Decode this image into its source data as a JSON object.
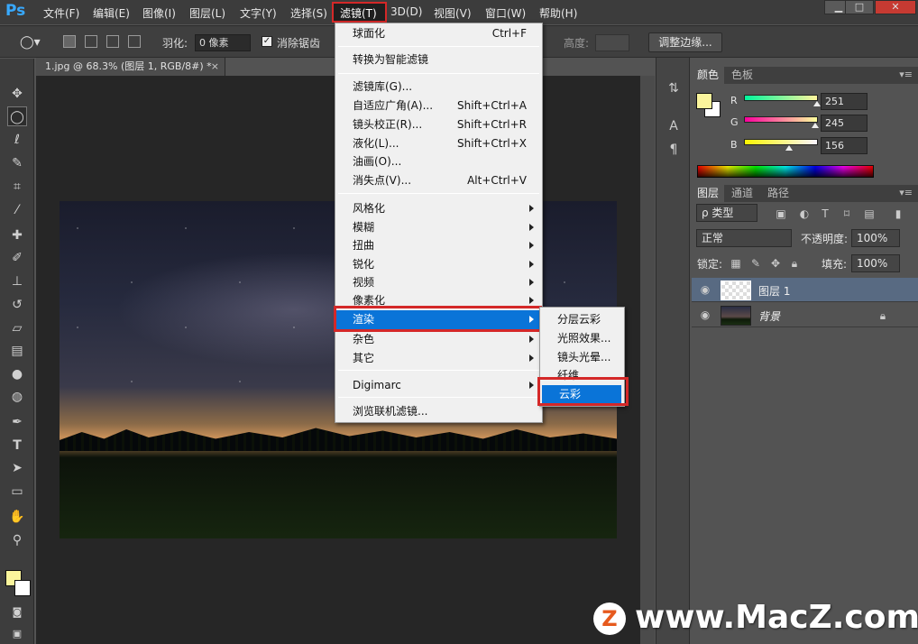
{
  "app": {
    "logo": "Ps"
  },
  "menubar": {
    "items": [
      "文件(F)",
      "编辑(E)",
      "图像(I)",
      "图层(L)",
      "文字(Y)",
      "选择(S)",
      "滤镜(T)",
      "3D(D)",
      "视图(V)",
      "窗口(W)",
      "帮助(H)"
    ],
    "active_item": "滤镜(T)"
  },
  "window_controls": {
    "minimize": "▁",
    "maximize": "□",
    "close": "✕"
  },
  "options_bar": {
    "feather_label": "羽化:",
    "feather_value": "0 像素",
    "antialias_label": "消除锯齿",
    "antialias_checked": "✓",
    "height_label": "高度:",
    "refine_edge_button": "调整边缘..."
  },
  "document": {
    "tab_title": "1.jpg @ 68.3% (图层 1, RGB/8#) *",
    "tab_close": "×"
  },
  "tools": [
    "move-icon",
    "marquee-icon",
    "lasso-icon",
    "quick-select-icon",
    "crop-icon",
    "eyedropper-icon",
    "healing-icon",
    "brush-icon",
    "stamp-icon",
    "history-brush-icon",
    "eraser-icon",
    "gradient-icon",
    "blur-icon",
    "dodge-icon",
    "pen-icon",
    "type-icon",
    "path-select-icon",
    "shape-icon",
    "hand-icon",
    "zoom-icon"
  ],
  "dock_icons": {
    "type": "A",
    "paragraph": "¶"
  },
  "color_panel": {
    "tabs": [
      "颜色",
      "色板"
    ],
    "r_label": "R",
    "g_label": "G",
    "b_label": "B",
    "r_value": "251",
    "g_value": "245",
    "b_value": "156",
    "r": 251,
    "g": 245,
    "b": 156,
    "foreground": "#fbf59c",
    "background": "#ffffff"
  },
  "layers_panel": {
    "tabs": [
      "图层",
      "通道",
      "路径"
    ],
    "filter_label": "ρ 类型",
    "blend_mode": "正常",
    "opacity_label": "不透明度:",
    "opacity_value": "100%",
    "lock_label": "锁定:",
    "fill_label": "填充:",
    "fill_value": "100%",
    "layers": [
      {
        "name": "图层 1",
        "selected": true
      },
      {
        "name": "背景",
        "selected": false
      }
    ]
  },
  "filter_menu": {
    "items": [
      {
        "label": "球面化",
        "shortcut": "Ctrl+F"
      },
      {
        "label": "转换为智能滤镜"
      },
      {
        "label": "滤镜库(G)..."
      },
      {
        "label": "自适应广角(A)...",
        "shortcut": "Shift+Ctrl+A"
      },
      {
        "label": "镜头校正(R)...",
        "shortcut": "Shift+Ctrl+R"
      },
      {
        "label": "液化(L)...",
        "shortcut": "Shift+Ctrl+X"
      },
      {
        "label": "油画(O)..."
      },
      {
        "label": "消失点(V)...",
        "shortcut": "Alt+Ctrl+V"
      },
      {
        "label": "风格化"
      },
      {
        "label": "模糊"
      },
      {
        "label": "扭曲"
      },
      {
        "label": "锐化"
      },
      {
        "label": "视频"
      },
      {
        "label": "像素化"
      },
      {
        "label": "渲染"
      },
      {
        "label": "杂色"
      },
      {
        "label": "其它"
      },
      {
        "label": "Digimarc"
      },
      {
        "label": "浏览联机滤镜..."
      }
    ],
    "highlighted": "渲染"
  },
  "render_submenu": {
    "items": [
      "分层云彩",
      "光照效果...",
      "镜头光晕...",
      "纤维",
      "云彩"
    ],
    "highlighted": "云彩"
  },
  "watermark": {
    "logo": "Z",
    "text": "www.MacZ.com"
  }
}
